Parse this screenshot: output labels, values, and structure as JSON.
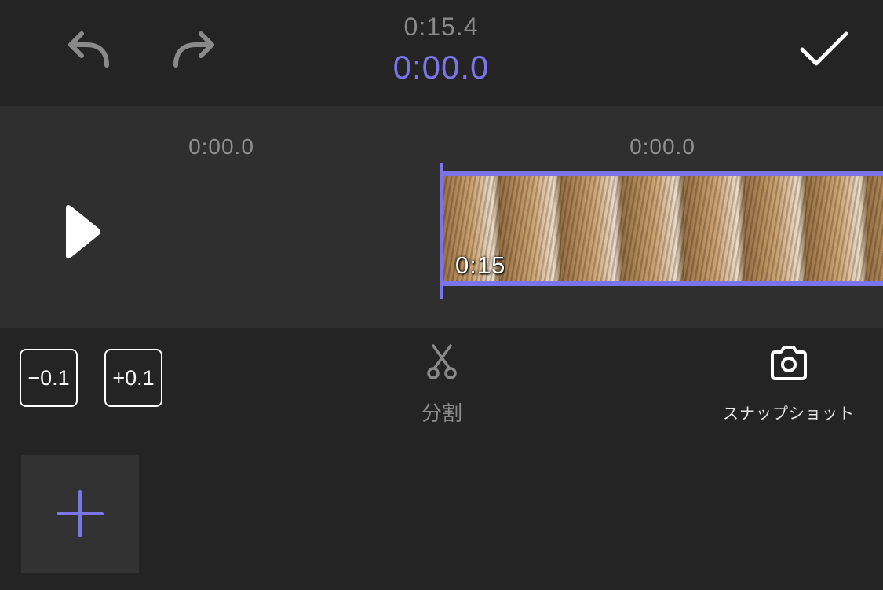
{
  "header": {
    "total_time": "0:15.4",
    "current_time": "0:00.0",
    "undo_icon": "undo-arrow-icon",
    "redo_icon": "redo-arrow-icon",
    "done_icon": "checkmark-icon"
  },
  "timeline": {
    "left_time": "0:00.0",
    "right_time": "0:00.0",
    "clip_duration": "0:15",
    "play_icon": "play-icon"
  },
  "tools": {
    "minus_label": "−0.1",
    "plus_label": "+0.1",
    "split_label": "分割",
    "split_icon": "scissors-icon",
    "snapshot_label": "スナップショット",
    "snapshot_icon": "camera-icon"
  },
  "add_tile": {
    "icon": "plus-icon"
  },
  "colors": {
    "accent": "#7b74ea",
    "background": "#242424",
    "timeline_bg": "#2f2f2f"
  }
}
